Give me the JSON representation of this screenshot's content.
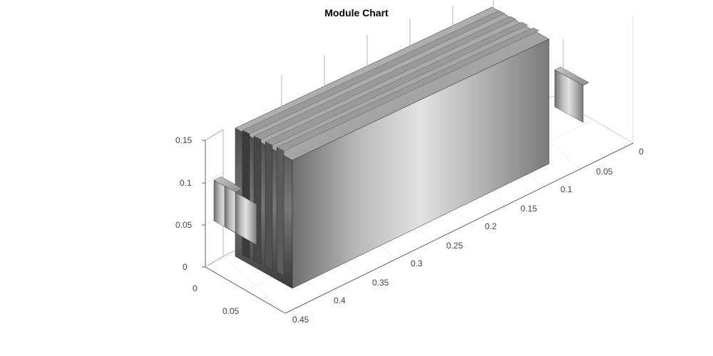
{
  "chart_data": {
    "type": "3d-surface",
    "title": "Module Chart",
    "x_axis": {
      "label": "",
      "ticks": [
        0,
        0.05,
        0.1,
        0.15,
        0.2,
        0.25,
        0.3,
        0.35,
        0.4,
        0.45
      ],
      "range": [
        0,
        0.45
      ],
      "direction": "front-right receding to back-left"
    },
    "y_axis": {
      "label": "",
      "ticks": [
        0,
        0.05
      ],
      "range": [
        0,
        0.1
      ],
      "direction": "front-left receding to back-right"
    },
    "z_axis": {
      "label": "",
      "ticks": [
        0,
        0.05,
        0.1,
        0.15
      ],
      "range": [
        0,
        0.15
      ]
    },
    "description": "3D rendering of a rectangular module composed of several parallel gray plates/panels running along the x-axis, with small tabs protruding on the short sides. Rendered with metallic silver shading in an isometric view.",
    "approx_module_extents": {
      "x": [
        0.02,
        0.4
      ],
      "y": [
        0.01,
        0.08
      ],
      "z": [
        0.0,
        0.13
      ]
    }
  }
}
